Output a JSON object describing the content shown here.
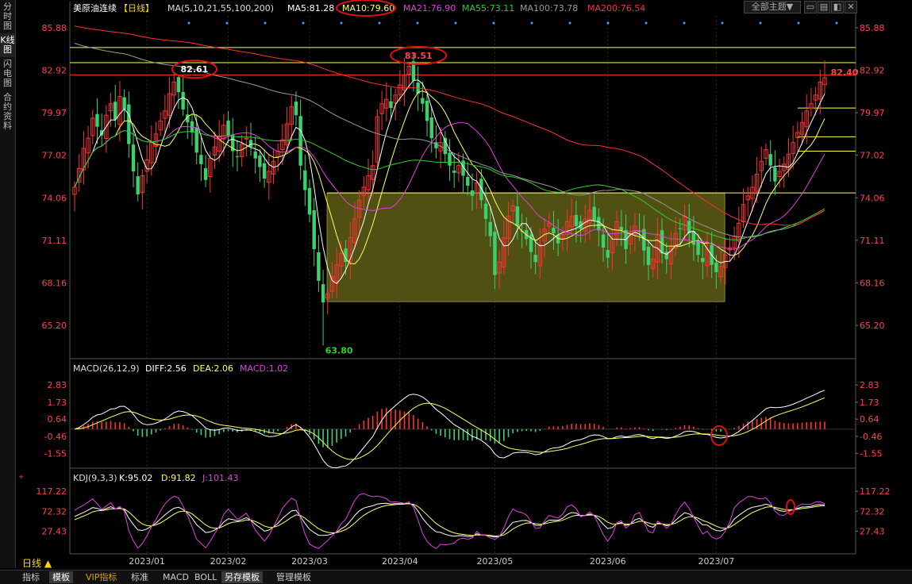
{
  "sidebar": [
    {
      "label": "分时图",
      "active": false
    },
    {
      "label": "K线图",
      "active": true
    },
    {
      "label": "闪电图",
      "active": false
    },
    {
      "label": "合约资料",
      "active": false
    }
  ],
  "main_header": {
    "title": "美原油连续",
    "period_tag": "【日线】",
    "ma_params": "MA(5,10,21,55,100,200)",
    "ma5": "MA5:81.28",
    "ma10": "MA10:79.60",
    "ma21": "MA21:76.90",
    "ma55": "MA55:73.11",
    "ma100": "MA100:73.78",
    "ma200": "MA200:76.54",
    "theme_button": "全部主题▼"
  },
  "macd_header": {
    "params": "MACD(26,12,9)",
    "diff": "DIFF:2.56",
    "dea": "DEA:2.06",
    "macd": "MACD:1.02"
  },
  "kdj_header": {
    "params": "KDJ(9,3,3)",
    "k": "K:95.02",
    "d": "D:91.82",
    "j": "J:101.43"
  },
  "bottom": {
    "period": "日线 ▲",
    "tabs": [
      {
        "label": "指标",
        "active": false,
        "vip": false
      },
      {
        "label": "模板",
        "active": true,
        "vip": false
      },
      {
        "label": "VIP指标",
        "active": false,
        "vip": true
      },
      {
        "label": "标准",
        "active": false,
        "vip": false
      },
      {
        "label": "MACD",
        "active": false,
        "vip": false
      },
      {
        "label": "BOLL",
        "active": false,
        "vip": false
      },
      {
        "label": "另存模板",
        "active": true,
        "vip": false
      },
      {
        "label": "管理模板",
        "active": false,
        "vip": false
      }
    ]
  },
  "colors": {
    "up": "#ff3232",
    "down": "#3cd070",
    "ma5": "#ffffff",
    "ma10": "#ffff66",
    "ma21": "#e040e0",
    "ma55": "#33cc33",
    "ma100": "#999999",
    "ma200": "#ff3030",
    "axis_text": "#ff4444",
    "hline": "#ffff44",
    "box": "#6b6b1a"
  },
  "chart_data": [
    {
      "type": "candlestick",
      "title": "美原油连续 日线",
      "x_ticks": [
        "2023/01",
        "2023/02",
        "2023/03",
        "2023/04",
        "2023/05",
        "2023/06",
        "2023/07"
      ],
      "y_ticks": [
        "85.88",
        "82.92",
        "79.97",
        "77.02",
        "74.06",
        "71.11",
        "68.16",
        "65.20"
      ],
      "ylim": [
        63.0,
        86.7
      ],
      "closes": [
        74.8,
        76.1,
        77.5,
        78.2,
        79.6,
        79.0,
        78.4,
        79.8,
        80.6,
        79.5,
        81.1,
        80.2,
        77.8,
        75.9,
        74.3,
        75.6,
        76.7,
        77.9,
        78.5,
        79.4,
        80.1,
        81.3,
        82.1,
        81.4,
        80.2,
        79.3,
        78.6,
        77.2,
        76.4,
        75.3,
        76.8,
        77.6,
        78.3,
        79.1,
        78.4,
        77.3,
        76.9,
        77.8,
        78.2,
        77.6,
        76.8,
        76.2,
        75.4,
        75.9,
        76.6,
        77.3,
        78.1,
        79.2,
        80.4,
        79.8,
        76.3,
        74.6,
        72.9,
        70.5,
        68.3,
        66.8,
        67.4,
        68.6,
        69.4,
        70.2,
        69.6,
        71.3,
        72.6,
        73.9,
        74.8,
        75.6,
        76.3,
        79.7,
        80.6,
        80.9,
        80.3,
        81.2,
        81.9,
        82.6,
        83.2,
        82.2,
        81.3,
        80.6,
        79.4,
        78.2,
        77.5,
        77.9,
        77.1,
        76.3,
        75.8,
        76.3,
        75.6,
        74.9,
        74.2,
        75.1,
        73.9,
        72.6,
        71.4,
        68.7,
        69.6,
        71.3,
        72.8,
        73.5,
        72.1,
        71.7,
        71.2,
        70.3,
        69.6,
        70.8,
        71.9,
        72.3,
        71.6,
        70.9,
        71.5,
        72.4,
        72.8,
        72.1,
        71.9,
        72.6,
        73.2,
        72.5,
        71.8,
        70.6,
        69.9,
        71.2,
        72.4,
        71.8,
        70.5,
        71.6,
        72.1,
        71.7,
        70.4,
        69.4,
        69.8,
        71.5,
        70.2,
        69.8,
        70.6,
        71.6,
        71.9,
        72.8,
        71.6,
        70.8,
        70.1,
        69.6,
        70.5,
        69.4,
        68.9,
        69.3,
        70.1,
        70.6,
        71.4,
        72.3,
        73.6,
        74.2,
        74.8,
        75.7,
        76.6,
        77.4,
        76.3,
        75.2,
        75.9,
        76.4,
        77.1,
        77.9,
        78.6,
        79.3,
        80.1,
        80.6,
        81.2,
        82.1,
        82.4
      ],
      "annotations": [
        {
          "text": "82.61",
          "value": 82.61,
          "circled": true
        },
        {
          "text": "83.51",
          "value": 83.51,
          "circled": true
        },
        {
          "text": "63.80",
          "value": 63.8,
          "circled": false
        },
        {
          "text": "82.40",
          "value": 82.4,
          "circled": false
        }
      ],
      "horizontal_lines": [
        84.5,
        83.45,
        82.6,
        80.3,
        78.3,
        77.3,
        74.4
      ],
      "consolidation_box": {
        "y_low": 66.85,
        "y_high": 74.4
      },
      "series": [
        {
          "name": "MA5",
          "value": 81.28
        },
        {
          "name": "MA10",
          "value": 79.6
        },
        {
          "name": "MA21",
          "value": 76.9
        },
        {
          "name": "MA55",
          "value": 73.11
        },
        {
          "name": "MA100",
          "value": 73.78
        },
        {
          "name": "MA200",
          "value": 76.54
        }
      ]
    },
    {
      "type": "bar",
      "title": "MACD(26,12,9)",
      "y_ticks": [
        "2.83",
        "1.73",
        "0.64",
        "-0.46",
        "-1.55"
      ],
      "ylim": [
        -2.4,
        3.4
      ],
      "series": [
        {
          "name": "DIFF",
          "value": 2.56
        },
        {
          "name": "DEA",
          "value": 2.06
        },
        {
          "name": "MACD",
          "value": 1.02
        }
      ]
    },
    {
      "type": "line",
      "title": "KDJ(9,3,3)",
      "y_ticks": [
        "117.22",
        "72.32",
        "27.43"
      ],
      "ylim": [
        -20,
        130
      ],
      "series": [
        {
          "name": "K",
          "value": 95.02
        },
        {
          "name": "D",
          "value": 91.82
        },
        {
          "name": "J",
          "value": 101.43
        }
      ]
    }
  ]
}
